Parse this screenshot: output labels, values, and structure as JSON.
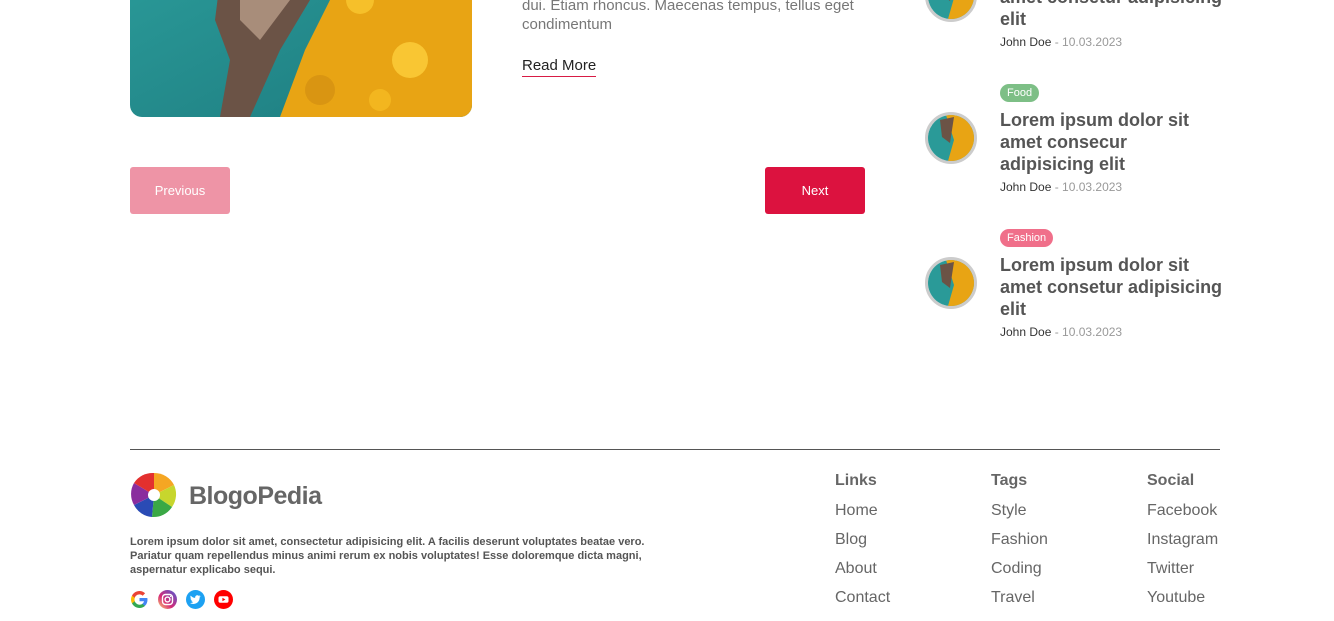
{
  "article": {
    "excerpt": "dui. Etiam rhoncus. Maecenas tempus, tellus eget condimentum",
    "read_more": "Read More"
  },
  "pagination": {
    "previous": "Previous",
    "next": "Next"
  },
  "sidebar": {
    "posts": [
      {
        "tag": "",
        "title": "amet consetur adipisicing elit",
        "author": "John Doe",
        "date": " - 10.03.2023"
      },
      {
        "tag": "Food",
        "title": "Lorem ipsum dolor sit amet consecur adipisicing elit",
        "author": "John Doe",
        "date": " - 10.03.2023"
      },
      {
        "tag": "Fashion",
        "title": "Lorem ipsum dolor sit amet consetur adipisicing elit",
        "author": "John Doe",
        "date": " - 10.03.2023"
      }
    ]
  },
  "footer": {
    "brand": "BlogoPedia",
    "about": "Lorem ipsum dolor sit amet, consectetur adipisicing elit. A facilis deserunt voluptates beatae vero. Pariatur quam repellendus minus animi rerum ex nobis voluptates! Esse doloremque dicta magni, aspernatur explicabo sequi.",
    "social_icons": [
      "google-icon",
      "instagram-icon",
      "twitter-icon",
      "youtube-icon"
    ],
    "columns": [
      {
        "heading": "Links",
        "items": [
          "Home",
          "Blog",
          "About",
          "Contact"
        ]
      },
      {
        "heading": "Tags",
        "items": [
          "Style",
          "Fashion",
          "Coding",
          "Travel"
        ]
      },
      {
        "heading": "Social",
        "items": [
          "Facebook",
          "Instagram",
          "Twitter",
          "Youtube"
        ]
      }
    ]
  },
  "colors": {
    "accent": "#dc123f",
    "accent_light": "#ee94a6",
    "food_tag": "#7dbf86",
    "fashion_tag": "#f06f8a"
  }
}
